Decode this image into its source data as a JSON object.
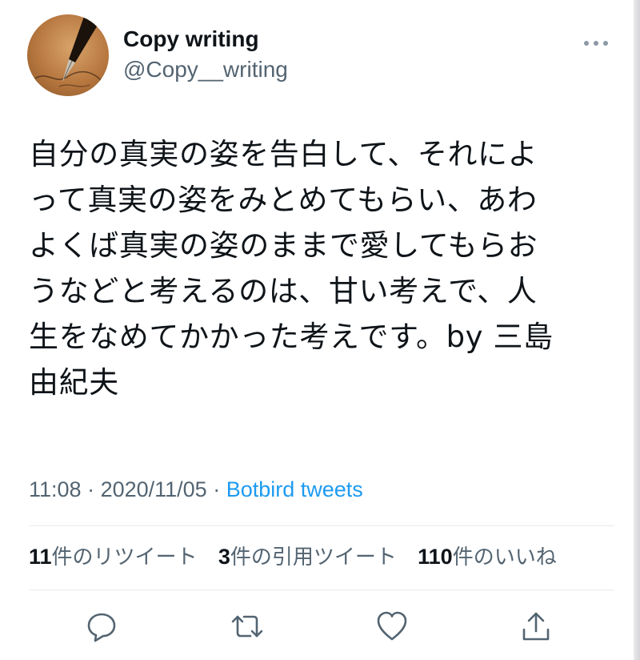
{
  "user": {
    "display_name": "Copy writing",
    "handle": "@Copy__writing"
  },
  "tweet": {
    "text": "自分の真実の姿を告白して、それによ\nって真実の姿をみとめてもらい、あわ\nよくば真実の姿のままで愛してもらお\nうなどと考えるのは、甘い考えで、人\n生をなめてかかった考えです。by 三島\n由紀夫",
    "time": "11:08",
    "date": "2020/11/05",
    "source": "Botbird tweets",
    "separator": " · "
  },
  "stats": {
    "retweets_count": "11",
    "retweets_label": "件のリツイート",
    "quotes_count": "3",
    "quotes_label": "件の引用ツイート",
    "likes_count": "110",
    "likes_label": "件のいいね"
  },
  "icons": {
    "more": "more-horizontal-icon",
    "reply": "reply-icon",
    "retweet": "retweet-icon",
    "like": "heart-icon",
    "share": "share-icon"
  },
  "colors": {
    "text": "#0f1419",
    "secondary": "#536471",
    "link": "#1d9bf0",
    "divider": "#e6ecf0"
  }
}
